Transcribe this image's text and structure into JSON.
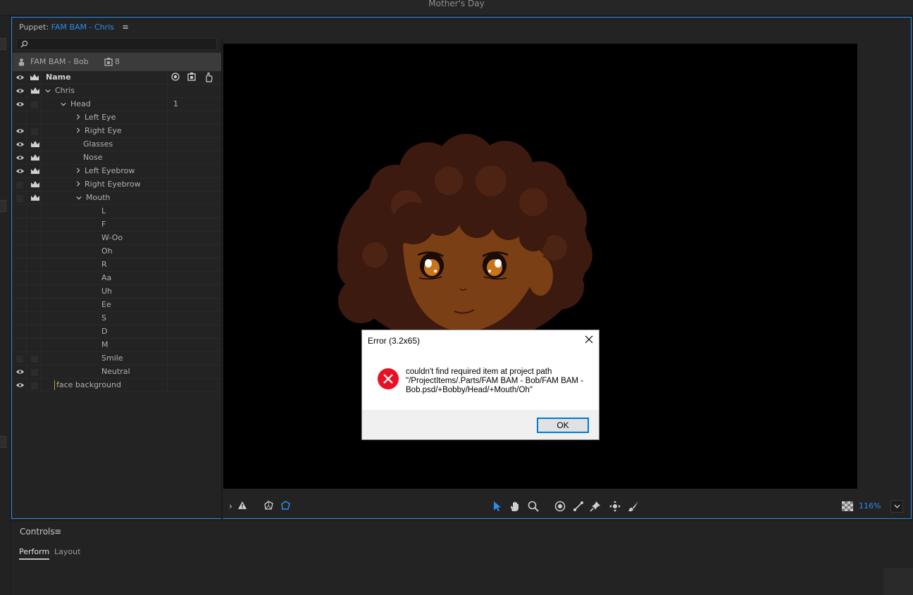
{
  "window": {
    "title": "Mother's Day"
  },
  "puppet_panel": {
    "label": "Puppet:",
    "puppet_name": "FAM BAM - Chris",
    "menu_glyph": "≡",
    "search": {
      "value": "",
      "placeholder": ""
    },
    "puppet_bar": {
      "name": "FAM BAM - Bob",
      "count": "8"
    },
    "columns": {
      "name": "Name"
    },
    "rows": [
      {
        "label": "Chris",
        "value": ""
      },
      {
        "label": "Head",
        "value": "1"
      },
      {
        "label": "Left Eye",
        "value": ""
      },
      {
        "label": "Right Eye",
        "value": ""
      },
      {
        "label": "Glasses",
        "value": ""
      },
      {
        "label": "Nose",
        "value": ""
      },
      {
        "label": "Left Eyebrow",
        "value": ""
      },
      {
        "label": "Right Eyebrow",
        "value": ""
      },
      {
        "label": "Mouth",
        "value": ""
      },
      {
        "label": "L",
        "value": ""
      },
      {
        "label": "F",
        "value": ""
      },
      {
        "label": "W-Oo",
        "value": ""
      },
      {
        "label": "Oh",
        "value": ""
      },
      {
        "label": "R",
        "value": ""
      },
      {
        "label": "Aa",
        "value": ""
      },
      {
        "label": "Uh",
        "value": ""
      },
      {
        "label": "Ee",
        "value": ""
      },
      {
        "label": "S",
        "value": ""
      },
      {
        "label": "D",
        "value": ""
      },
      {
        "label": "M",
        "value": ""
      },
      {
        "label": "Smile",
        "value": ""
      },
      {
        "label": "Neutral",
        "value": ""
      },
      {
        "label": "face background",
        "value": ""
      }
    ]
  },
  "toolbar": {
    "zoom": "116%"
  },
  "controls_panel": {
    "title": "Controls",
    "menu_glyph": "≡",
    "tabs": [
      {
        "label": "Perform"
      },
      {
        "label": "Layout"
      }
    ]
  },
  "dialog": {
    "title": "Error (3.2x65)",
    "message_line1": "couldn't find required item at project path",
    "message_line2": "\"/ProjectItems/.Parts/FAM BAM - Bob/FAM BAM -",
    "message_line3": "Bob.psd/+Bobby/Head/+Mouth/Oh\"",
    "ok_label": "OK"
  },
  "colors": {
    "accent": "#2d8ceb",
    "error": "#e81123",
    "canvas": "#000000"
  }
}
